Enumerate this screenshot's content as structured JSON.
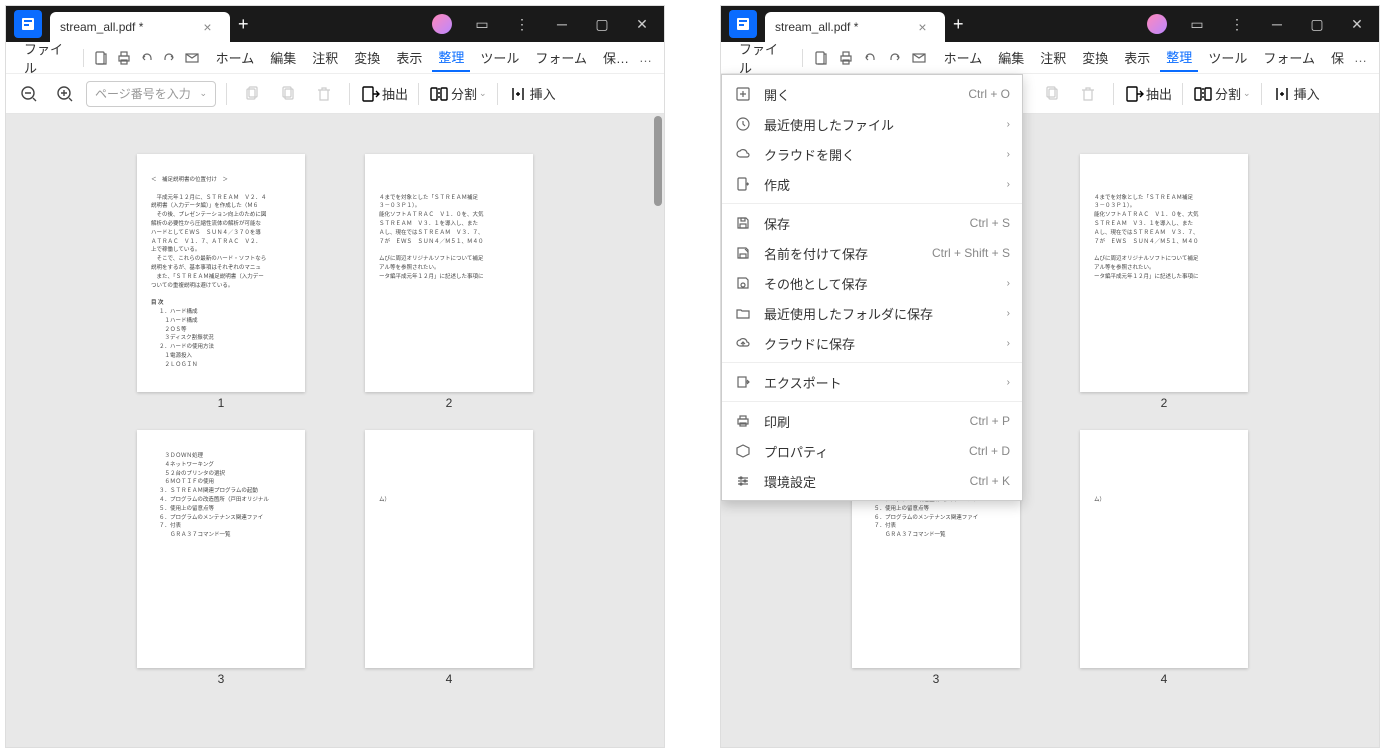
{
  "tab": {
    "title": "stream_all.pdf *"
  },
  "filemenu": {
    "label": "ファイル"
  },
  "menubar": {
    "items": [
      "ホーム",
      "編集",
      "注釈",
      "変換",
      "表示",
      "整理",
      "ツール",
      "フォーム",
      "保…"
    ],
    "items_right": [
      "ホーム",
      "編集",
      "注釈",
      "変換",
      "表示",
      "整理",
      "ツール",
      "フォーム",
      "保"
    ],
    "active_index": 5
  },
  "toolbar": {
    "page_placeholder": "ページ番号を入力",
    "extract": "抽出",
    "split": "分割",
    "insert": "挿入"
  },
  "pages": {
    "labels": [
      "1",
      "2",
      "3",
      "4"
    ],
    "p1": {
      "header": "＜　補足説明書の位置付け　＞",
      "t1": "　平成元年１２月に、ＳＴＲＥＡＭ　Ｖ２．４",
      "t2": "説明書（入力データ編）」を作成した（Ｍ６",
      "t3": "　その後、プレゼンテーション向上のために図",
      "t4": "解析の必要性から圧縮性流体の解析が可能な",
      "t5": "ハードとしてＥＷＳ　ＳＵＮ４／３７０を導",
      "t6": "ＡＴＲＡＣ　Ｖ１．７、ＡＴＲＡＣ　Ｖ２．",
      "t7": "上で稼働している。",
      "t8": "　そこで、これらの最新のハード・ソフトなら",
      "t9": "説明をするが、基本事項はそれぞれのマニュ",
      "t10": "　また、「ＳＴＲＥＡＭ補足説明書（入力デー",
      "t11": "ついての重複説明は避けている。",
      "toc_title": "目 次",
      "toc": [
        "１．ハード構成",
        "　１ハード構成",
        "　２ＯＳ等",
        "　３ディスク割振状況",
        "２．ハードの使用方法",
        "　１電源投入",
        "　２ＬＯＧＩＮ"
      ]
    },
    "p2": {
      "t1": "４までを対象とした「ＳＴＲＥＡＭ補足",
      "t2": "３－０３Ｐ１）。",
      "t3": "能化ソフトＡＴＲＡＣ　Ｖ１．０を、大気",
      "t4": "ＳＴＲＥＡＭ　Ｖ３．１を導入し、また",
      "t5": "Ａし、現在ではＳＴＲＥＡＭ　Ｖ３．７、",
      "t6": "７が　ＥＷＳ　ＳＵＮ４／Ｍ５１、Ｍ４０",
      "t7": "",
      "t8": "ムびに周辺オリジナルソフトについて補足",
      "t9": "アル等を参照されたい。",
      "t10": "ータ編平成元年１２月」に記述した事項に"
    },
    "p3": {
      "toc": [
        "　３ＤＯＷＮ処理",
        "　４ネットワーキング",
        "　５２台のプリンタの選択",
        "　６ＭＯＴＩＦの使用",
        "３．ＳＴＲＥＡＭ関連プログラムの起動",
        "４．プログラムの改造箇所（戸田オリジナル",
        "５．使用上の留意点等",
        "６．プログラムのメンテナンス関連ファイ",
        "７．付表",
        "　　ＧＲＡ３７コマンド一覧"
      ]
    },
    "p4": {
      "line": "ム）"
    }
  },
  "dropdown": {
    "items": [
      {
        "label": "開く",
        "shortcut": "Ctrl + O",
        "icon": "plus"
      },
      {
        "label": "最近使用したファイル",
        "arrow": true,
        "icon": "clock"
      },
      {
        "label": "クラウドを開く",
        "arrow": true,
        "icon": "cloud"
      },
      {
        "label": "作成",
        "arrow": true,
        "icon": "create"
      },
      {
        "sep": true
      },
      {
        "label": "保存",
        "shortcut": "Ctrl + S",
        "icon": "save"
      },
      {
        "label": "名前を付けて保存",
        "shortcut": "Ctrl + Shift + S",
        "icon": "saveas"
      },
      {
        "label": "その他として保存",
        "arrow": true,
        "icon": "saveother"
      },
      {
        "label": "最近使用したフォルダに保存",
        "arrow": true,
        "icon": "folder"
      },
      {
        "label": "クラウドに保存",
        "arrow": true,
        "icon": "cloudup"
      },
      {
        "sep": true
      },
      {
        "label": "エクスポート",
        "arrow": true,
        "icon": "export"
      },
      {
        "sep": true
      },
      {
        "label": "印刷",
        "shortcut": "Ctrl + P",
        "icon": "print"
      },
      {
        "label": "プロパティ",
        "shortcut": "Ctrl + D",
        "icon": "prop"
      },
      {
        "label": "環境設定",
        "shortcut": "Ctrl + K",
        "icon": "settings"
      }
    ]
  }
}
